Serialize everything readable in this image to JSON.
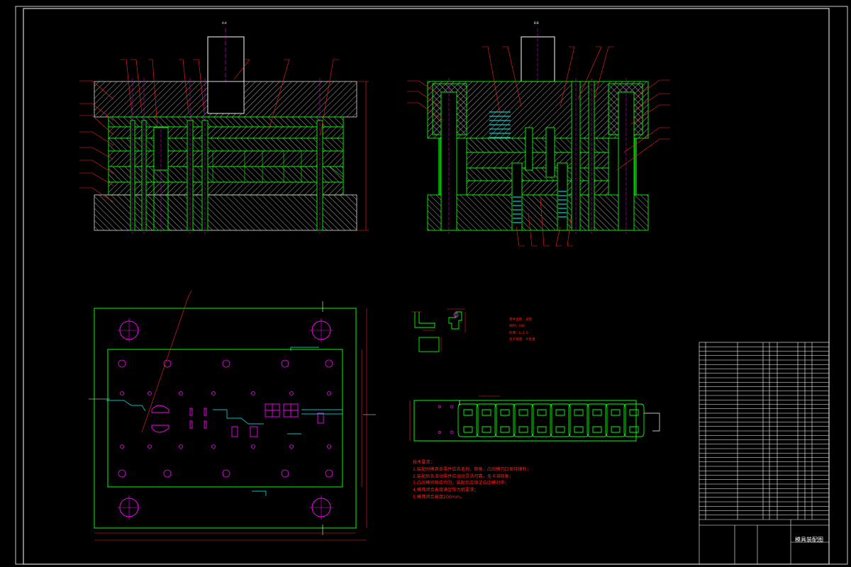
{
  "colors": {
    "background": "#000000",
    "frame": "#ffffff",
    "outline": "#00ff00",
    "hatch": "#b0b0b0",
    "leader": "#ff2020",
    "center": "#ff00ff",
    "cyan": "#00ffff",
    "spring": "#00d0d0"
  },
  "section_a_label": "A-A",
  "section_b_label": "B-B",
  "tech_notes": {
    "title": "技术要求：",
    "items": [
      "1.装配时模具各零件应去毛刺、倒角，凸凹模刃口保持锋利；",
      "2.装配后各活动零件应运动灵活可靠，无卡滞现象；",
      "3.凸凹模间隙应均匀，装配后应保证凸凹模对中；",
      "4.模具闭合高度满足压力机要求；",
      "5.模具闭合高度200mm。"
    ]
  },
  "part_spec": {
    "items": [
      "零件名称：支架",
      "材料：08F",
      "料厚：t=1.0",
      "生产批量：大批量"
    ]
  },
  "title_block": {
    "drawing_title": "模具装配图"
  },
  "bom_rows": 40
}
